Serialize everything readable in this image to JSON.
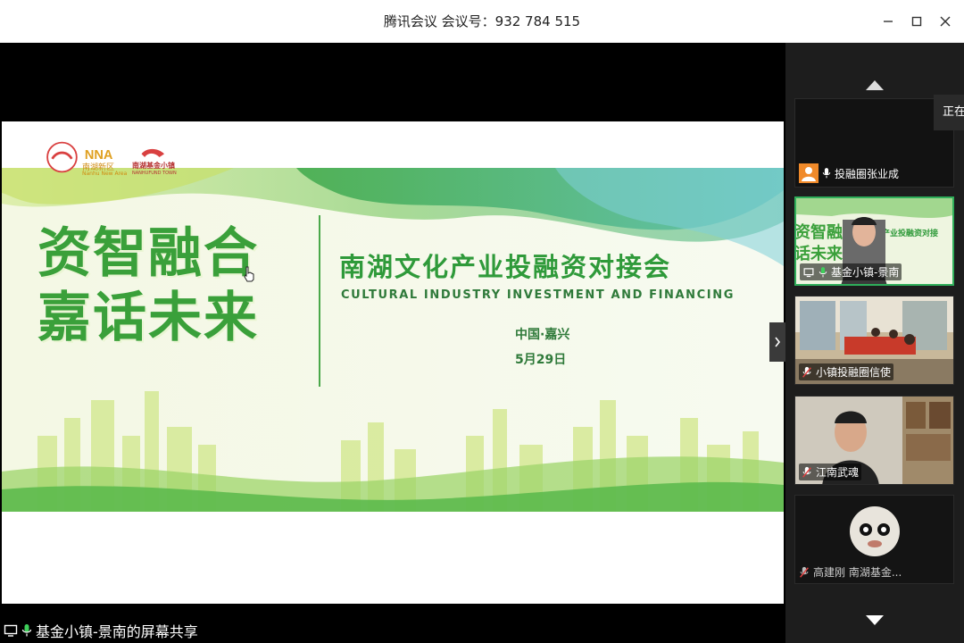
{
  "window": {
    "title": "腾讯会议  会议号：932 784 515",
    "minimize_glyph": "—",
    "maximize_glyph": "☐",
    "close_glyph": "✕"
  },
  "slide": {
    "logos": {
      "left_emblem_text": "",
      "brand1_line1": "南湖新区",
      "brand1_line2": "Nanhu New Area",
      "brand2_line1": "南湖基金小镇",
      "brand2_line2": "NANHUFUND TOWN"
    },
    "headline_line1": "资智融合",
    "headline_line2": "嘉话未来",
    "subtitle_cn": "南湖文化产业投融资对接会",
    "subtitle_en": "CULTURAL INDUSTRY INVESTMENT AND FINANCING",
    "place": "中国·嘉兴",
    "date": "5月29日"
  },
  "share_label": "基金小镇-景南的屏幕共享",
  "participants": [
    {
      "name": "投融圈张业成",
      "muted": false,
      "active": false
    },
    {
      "name": "基金小镇-景南",
      "muted": false,
      "active": true
    },
    {
      "name": "小镇投融圈信使",
      "muted": true,
      "active": false
    },
    {
      "name": "江南武魂",
      "muted": true,
      "active": false
    },
    {
      "name": "高建刚 南湖基金...",
      "muted": true,
      "active": false
    }
  ],
  "tooltip_text": "正在",
  "colors": {
    "accent_green": "#3aa03a",
    "active_border": "#2fae5a",
    "mute_red": "#e04040"
  }
}
